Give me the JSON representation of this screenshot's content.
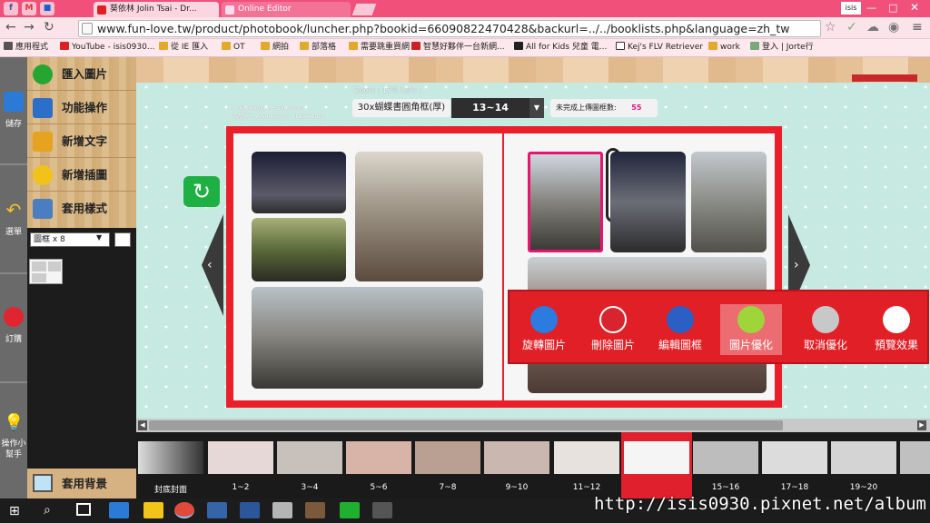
{
  "browser": {
    "tabs": [
      {
        "label": "葵依林 Jolin Tsai - Dr...",
        "active": false
      },
      {
        "label": "Online Editor",
        "active": true
      }
    ],
    "pinned": [
      "f",
      "M",
      "■"
    ],
    "url": "www.fun-love.tw/product/photobook/luncher.php?bookid=66090822470428&backurl=../../booklists.php&language=zh_tw",
    "profile": "isis",
    "bookmarks": [
      "應用程式",
      "YouTube - isis0930...",
      "從 IE 匯入",
      "OT",
      "網拍",
      "部落格",
      "需要跳重買網",
      "智慧好夥伴一台新網...",
      "All for Kids 兒童 電...",
      "Kej's FLV Retriever",
      "work",
      "登入 | Jorte行"
    ]
  },
  "leftbar": [
    {
      "label": "儲存",
      "icon": "save-icon"
    },
    {
      "label": "選單",
      "icon": "undo-icon"
    },
    {
      "label": "訂購",
      "icon": "cart-icon"
    },
    {
      "label": "操作小幫手",
      "icon": "lightbulb-icon"
    }
  ],
  "menu": [
    {
      "label": "匯入圖片",
      "icon": "plus-icon",
      "color": "#27a532"
    },
    {
      "label": "功能操作",
      "icon": "tools-icon",
      "color": "#2c6fc9"
    },
    {
      "label": "新增文字",
      "icon": "pencil-icon",
      "color": "#e6a320"
    },
    {
      "label": "新增插圖",
      "icon": "smiley-icon",
      "color": "#f2c21b"
    },
    {
      "label": "套用樣式",
      "icon": "layout-icon",
      "color": "#4a7ec0"
    }
  ],
  "frame_select": "圖框 x 8",
  "bg_button": "套用背景",
  "toolbar": {
    "zoom_text": "Zoom : 15%  Usm :",
    "size_lines": [
      "W:600.0mm - H:298.0mm",
      "成品尺寸 A:598.5mm - H:295.1mm"
    ],
    "product": "30x蝴蝶書圓角框(厚)",
    "page_range": "13~14",
    "remaining_label": "未完成上傳圖框數:",
    "remaining_count": "55"
  },
  "popup": [
    {
      "label": "旋轉圖片",
      "icon": "rotate-90-icon",
      "color": "#2c7be0"
    },
    {
      "label": "刪除圖片",
      "icon": "delete-x-icon",
      "color": "#d8242e"
    },
    {
      "label": "編輯圖框",
      "icon": "grid-icon",
      "color": "#2b5fc4"
    },
    {
      "label": "圖片優化",
      "icon": "sparkle-icon",
      "color": "#9fd43a",
      "selected": true
    },
    {
      "label": "取消優化",
      "icon": "sparkle-gray-icon",
      "color": "#c8c8c8"
    },
    {
      "label": "預覽效果",
      "icon": "eye-icon",
      "color": "#2c7be0"
    }
  ],
  "filmstrip": [
    {
      "label": "封底封面"
    },
    {
      "label": "1~2"
    },
    {
      "label": "3~4"
    },
    {
      "label": "5~6"
    },
    {
      "label": "7~8"
    },
    {
      "label": "9~10"
    },
    {
      "label": "11~12"
    },
    {
      "label": ""
    },
    {
      "label": "15~16"
    },
    {
      "label": "17~18"
    },
    {
      "label": "19~20"
    },
    {
      "label": ""
    }
  ],
  "watermark": "http://isis0930.pixnet.net/album"
}
